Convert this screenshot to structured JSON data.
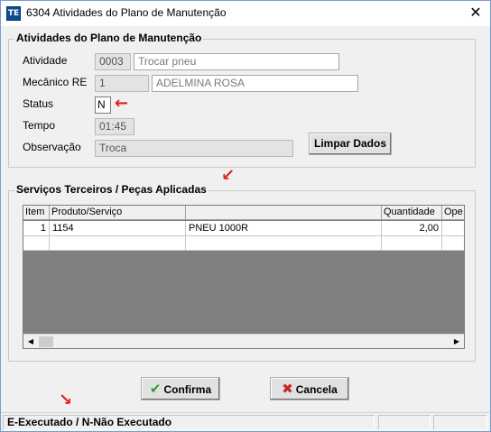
{
  "window": {
    "title": "6304 Atividades do Plano de Manutenção",
    "icon": "TE",
    "close": "✕"
  },
  "group1": {
    "title": "Atividades do Plano de Manutenção",
    "atividade": {
      "label": "Atividade",
      "code": "0003",
      "desc": "Trocar pneu"
    },
    "mecanico": {
      "label": "Mecânico  RE",
      "code": "1",
      "name": "ADELMINA ROSA"
    },
    "status": {
      "label": "Status",
      "value": "N"
    },
    "tempo": {
      "label": "Tempo",
      "value": "01:45"
    },
    "observacao": {
      "label": "Observação",
      "value": "Troca"
    },
    "limpar_label": "Limpar Dados"
  },
  "group2": {
    "title": "Serviços Terceiros / Peças Aplicadas",
    "columns": [
      "Item",
      "Produto/Serviço",
      "",
      "Quantidade",
      "Ope"
    ],
    "rows": [
      {
        "item": "1",
        "produto": "1154",
        "descricao": "PNEU 1000R",
        "quantidade": "2,00",
        "ope": ""
      }
    ]
  },
  "buttons": {
    "confirma": "Confirma",
    "cancela": "Cancela"
  },
  "statusbar": {
    "text": "E-Executado / N-Não Executado",
    "pane2": "",
    "pane3": ""
  },
  "icons": {
    "confirm_icon": "check-icon",
    "cancel_icon": "x-icon",
    "arrow": "red-arrow-icon"
  },
  "colors": {
    "arrow": "#e02020",
    "check": "#2a9d2a",
    "cancel_x": "#c62828"
  }
}
